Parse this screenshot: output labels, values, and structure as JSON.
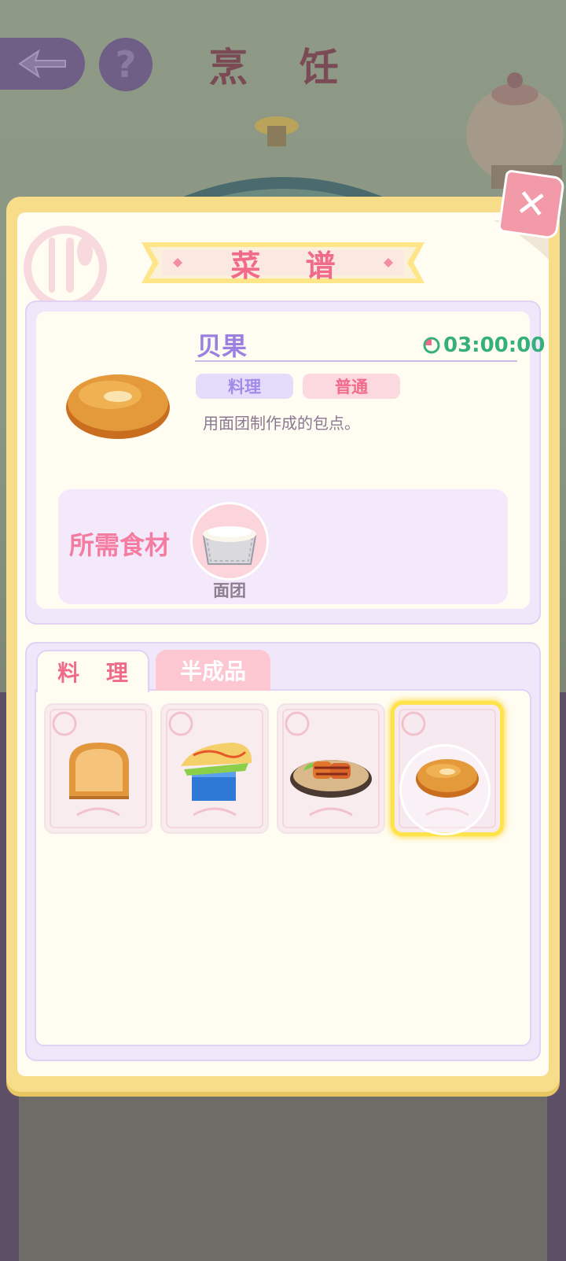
{
  "scene": {
    "title": "烹 饪",
    "help_glyph": "?"
  },
  "panel": {
    "title": "菜 谱",
    "close_glyph": "✕"
  },
  "recipe": {
    "name": "贝果",
    "timer": "03:00:00",
    "type_tag": "料理",
    "rarity_tag": "普通",
    "description": "用面团制作成的包点。",
    "ingredients_label": "所需食材",
    "ingredients": [
      {
        "name": "面团",
        "icon": "dough-tray-icon"
      }
    ]
  },
  "tabs": [
    {
      "label": "料 理",
      "active": true
    },
    {
      "label": "半成品",
      "active": false
    }
  ],
  "recipe_list": [
    {
      "icon": "bread-loaf-icon",
      "selected": false
    },
    {
      "icon": "sandwich-icon",
      "selected": false
    },
    {
      "icon": "glazed-chicken-plate-icon",
      "selected": false
    },
    {
      "icon": "bagel-icon",
      "selected": true
    }
  ],
  "colors": {
    "accent_pink": "#f06b8a",
    "accent_purple": "#9b80e0",
    "timer_green": "#34b07a",
    "panel_gold": "#f7dc8a",
    "selection_yellow": "#ffe34a"
  }
}
